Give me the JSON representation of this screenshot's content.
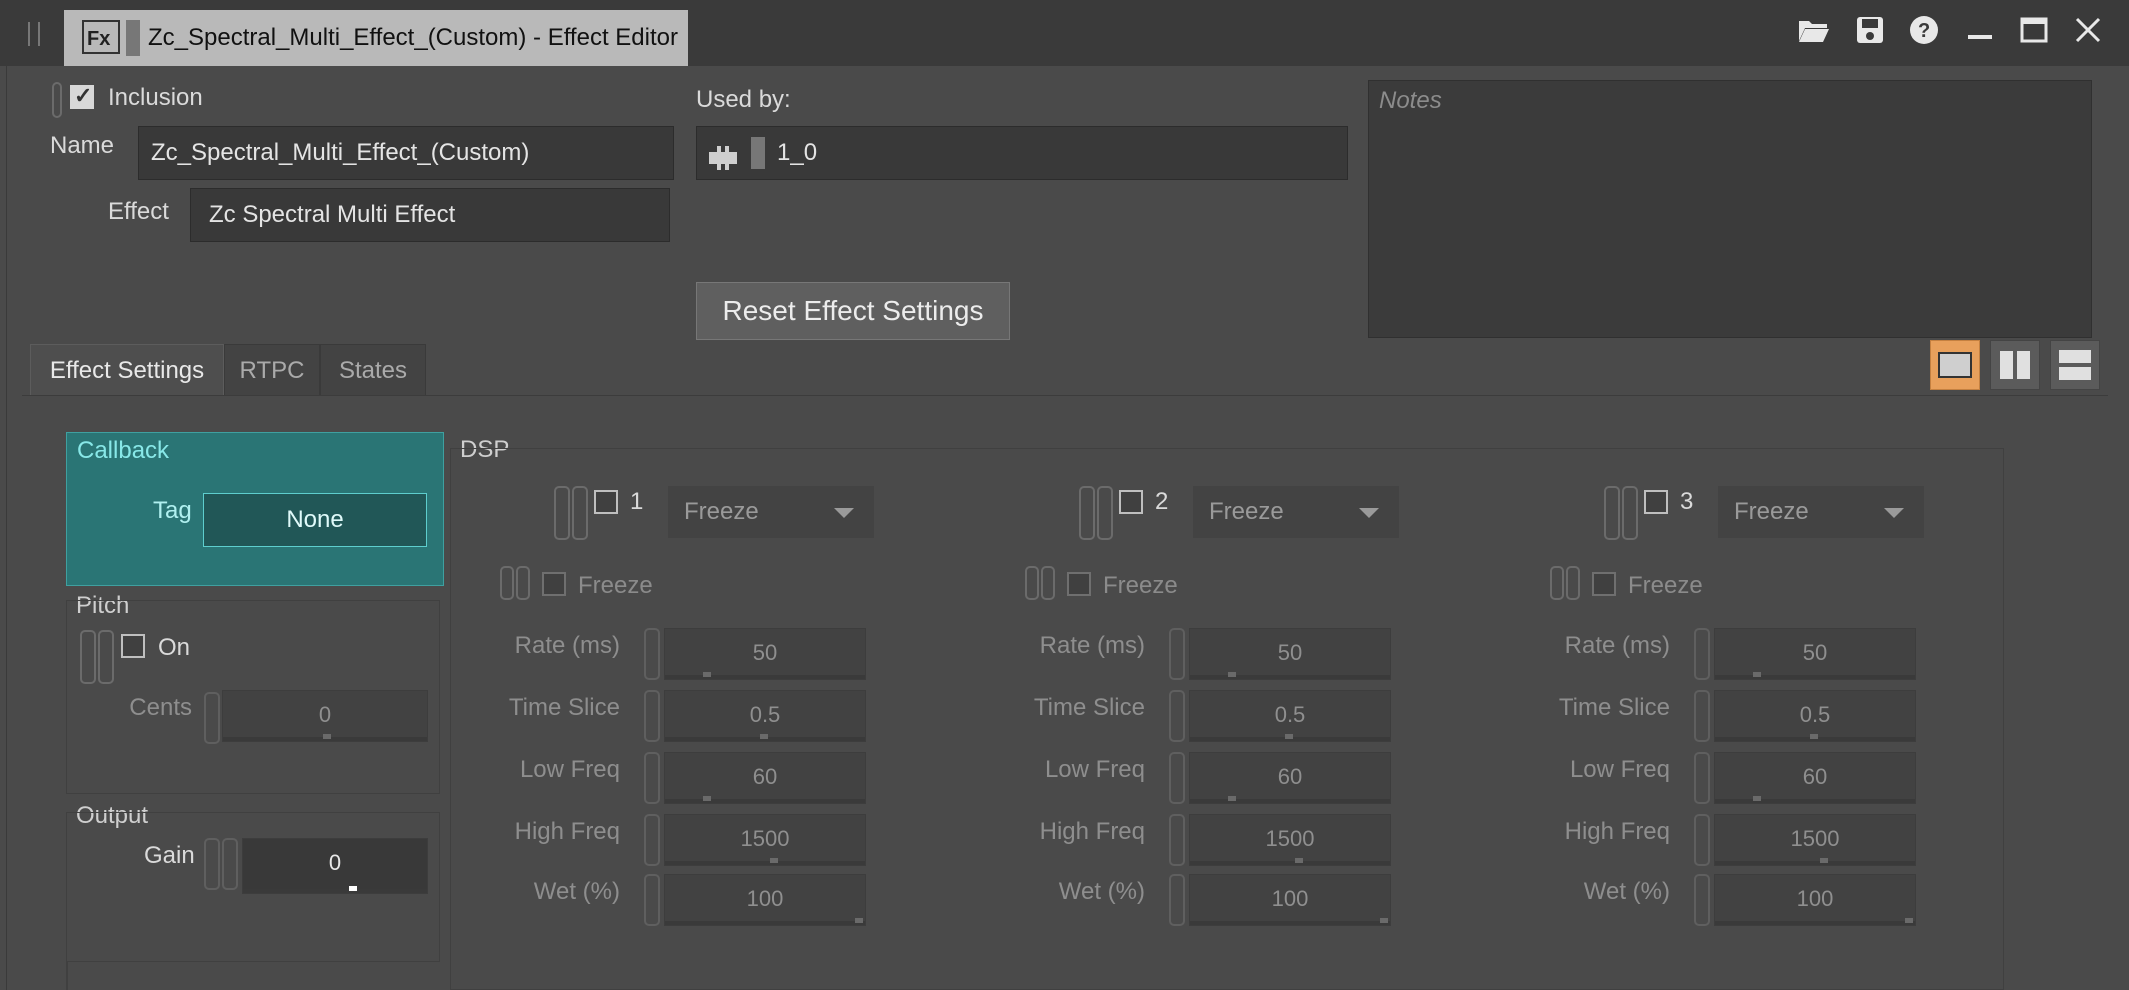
{
  "window": {
    "title": "Zc_Spectral_Multi_Effect_(Custom) - Effect Editor",
    "icon": "fx-icon",
    "toolbar": [
      "folder-open-icon",
      "save-icon",
      "help-icon",
      "minimize-icon",
      "maximize-icon",
      "close-icon"
    ]
  },
  "header": {
    "inclusion_label": "Inclusion",
    "inclusion_checked": true,
    "name_label": "Name",
    "name_value": "Zc_Spectral_Multi_Effect_(Custom)",
    "effect_label": "Effect",
    "effect_value": "Zc Spectral Multi Effect",
    "used_by_label": "Used by:",
    "used_by_value": "1_0",
    "notes_placeholder": "Notes",
    "reset_button": "Reset Effect Settings"
  },
  "tabs": [
    {
      "label": "Effect Settings",
      "active": true
    },
    {
      "label": "RTPC",
      "active": false
    },
    {
      "label": "States",
      "active": false
    }
  ],
  "layout_buttons": [
    "single-pane-icon",
    "two-columns-icon",
    "two-rows-icon"
  ],
  "callback": {
    "title": "Callback",
    "tag_label": "Tag",
    "tag_value": "None"
  },
  "pitch": {
    "title": "Pitch",
    "on_label": "On",
    "on_checked": false,
    "cents_label": "Cents",
    "cents_value": "0"
  },
  "output": {
    "title": "Output",
    "gain_label": "Gain",
    "gain_value": "0"
  },
  "dsp": {
    "title": "DSP",
    "slots": [
      {
        "number": "1",
        "mode": "Freeze",
        "freeze_label": "Freeze",
        "params": [
          {
            "label": "Rate (ms)",
            "value": "50"
          },
          {
            "label": "Time Slice",
            "value": "0.5"
          },
          {
            "label": "Low Freq",
            "value": "60"
          },
          {
            "label": "High Freq",
            "value": "1500"
          },
          {
            "label": "Wet (%)",
            "value": "100"
          }
        ]
      },
      {
        "number": "2",
        "mode": "Freeze",
        "freeze_label": "Freeze",
        "params": [
          {
            "label": "Rate (ms)",
            "value": "50"
          },
          {
            "label": "Time Slice",
            "value": "0.5"
          },
          {
            "label": "Low Freq",
            "value": "60"
          },
          {
            "label": "High Freq",
            "value": "1500"
          },
          {
            "label": "Wet (%)",
            "value": "100"
          }
        ]
      },
      {
        "number": "3",
        "mode": "Freeze",
        "freeze_label": "Freeze",
        "params": [
          {
            "label": "Rate (ms)",
            "value": "50"
          },
          {
            "label": "Time Slice",
            "value": "0.5"
          },
          {
            "label": "Low Freq",
            "value": "60"
          },
          {
            "label": "High Freq",
            "value": "1500"
          },
          {
            "label": "Wet (%)",
            "value": "100"
          }
        ]
      }
    ]
  },
  "colors": {
    "background": "#4a4a4a",
    "callback_bg": "#2a7575",
    "active_layout": "#e8a05c"
  }
}
